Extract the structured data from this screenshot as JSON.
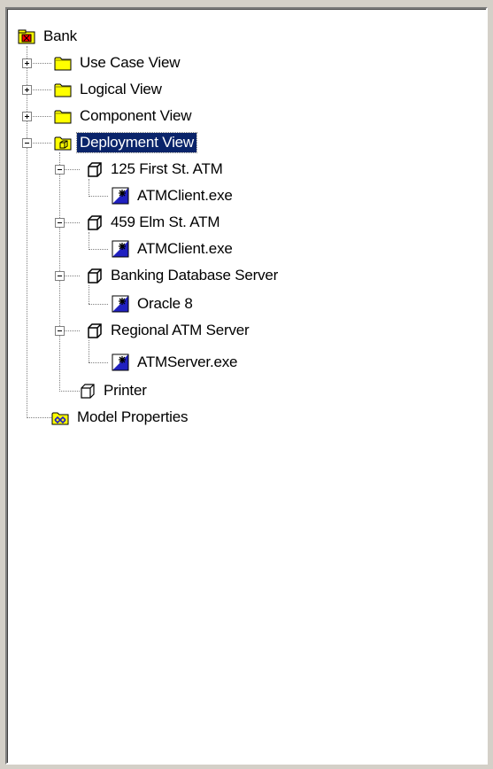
{
  "tree": {
    "root": {
      "label": "Bank",
      "icon": "model-icon"
    },
    "use_case_view": {
      "label": "Use Case View",
      "icon": "folder-icon"
    },
    "logical_view": {
      "label": "Logical View",
      "icon": "folder-icon"
    },
    "component_view": {
      "label": "Component View",
      "icon": "folder-icon"
    },
    "deployment_view": {
      "label": "Deployment View",
      "icon": "deployment-folder-icon",
      "selected": true
    },
    "nodes": [
      {
        "label": "125 First St. ATM",
        "icon": "node-cube-icon",
        "child": {
          "label": "ATMClient.exe",
          "icon": "process-icon"
        }
      },
      {
        "label": "459 Elm St. ATM",
        "icon": "node-cube-icon",
        "child": {
          "label": "ATMClient.exe",
          "icon": "process-icon"
        }
      },
      {
        "label": "Banking Database Server",
        "icon": "node-cube-icon",
        "child": {
          "label": "Oracle 8",
          "icon": "process-icon"
        }
      },
      {
        "label": "Regional ATM Server",
        "icon": "node-cube-icon",
        "child": {
          "label": "ATMServer.exe",
          "icon": "process-icon"
        }
      }
    ],
    "printer": {
      "label": "Printer",
      "icon": "device-cube-icon"
    },
    "model_properties": {
      "label": "Model Properties",
      "icon": "properties-icon"
    }
  },
  "colors": {
    "selection": "#0a246a",
    "window_bg": "#d4d0c8",
    "folder_yellow": "#ffff00"
  }
}
